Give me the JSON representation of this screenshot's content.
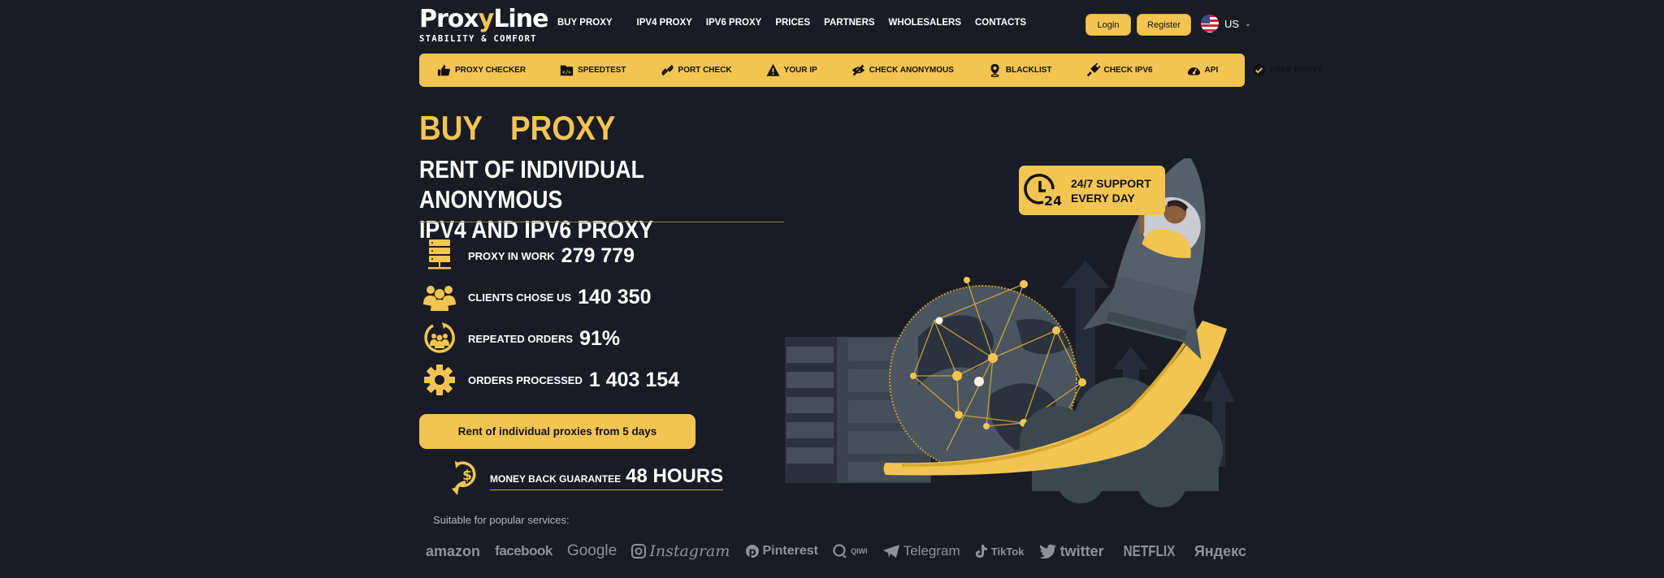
{
  "header": {
    "logo": {
      "name_a": "Proxy",
      "name_y": "y",
      "name_b": "Line",
      "name_pre": "Prox",
      "tagline": "STABILITY & COMFORT"
    },
    "nav": [
      "BUY PROXY",
      "IPV4 PROXY",
      "IPV6 PROXY",
      "PRICES",
      "PARTNERS",
      "WHOLESALERS",
      "CONTACTS"
    ],
    "login": "Login",
    "register": "Register",
    "language": "US"
  },
  "tools": [
    {
      "label": "PROXY CHECKER",
      "icon": "thumbs-up-icon"
    },
    {
      "label": "SPEEDTEST",
      "icon": "code-folder-icon"
    },
    {
      "label": "PORT CHECK",
      "icon": "link-icon"
    },
    {
      "label": "YOUR IP",
      "icon": "warning-icon"
    },
    {
      "label": "CHECK ANONYMOUS",
      "icon": "eye-slash-icon"
    },
    {
      "label": "BLACKLIST",
      "icon": "map-pin-icon"
    },
    {
      "label": "CHECK IPV6",
      "icon": "plug-icon"
    },
    {
      "label": "API",
      "icon": "gauge-icon"
    },
    {
      "label": "FREE PROXY",
      "icon": "check-circle-icon"
    }
  ],
  "hero": {
    "title": "BUY  PROXY",
    "subtitle_line1": "RENT OF INDIVIDUAL ANONYMOUS",
    "subtitle_line2": "IPV4 AND IPV6 PROXY",
    "stats": [
      {
        "label": "PROXY IN WORK",
        "value": "279 779",
        "icon": "server-icon"
      },
      {
        "label": "CLIENTS CHOSE US",
        "value": "140 350",
        "icon": "users-icon"
      },
      {
        "label": "REPEATED ORDERS",
        "value": "91%",
        "icon": "repeat-users-icon"
      },
      {
        "label": "ORDERS PROCESSED",
        "value": "1 403 154",
        "icon": "gear-icon"
      }
    ],
    "cta": "Rent of individual proxies from 5 days",
    "money_back_label": "MONEY BACK GUARANTEE",
    "money_back_value": "48 HOURS",
    "suitable": "Suitable for popular services:"
  },
  "support": {
    "line1": "24/7 SUPPORT",
    "line2": "EVERY DAY",
    "badge": "24"
  },
  "brands": [
    "amazon",
    "facebook",
    "Google",
    "Instagram",
    "Pinterest",
    "QIWI",
    "Telegram",
    "TikTok",
    "twitter",
    "NETFLIX",
    "Яндекс"
  ],
  "colors": {
    "accent": "#f2c552",
    "background": "#191c25",
    "brand_gray": "#8e9199"
  }
}
